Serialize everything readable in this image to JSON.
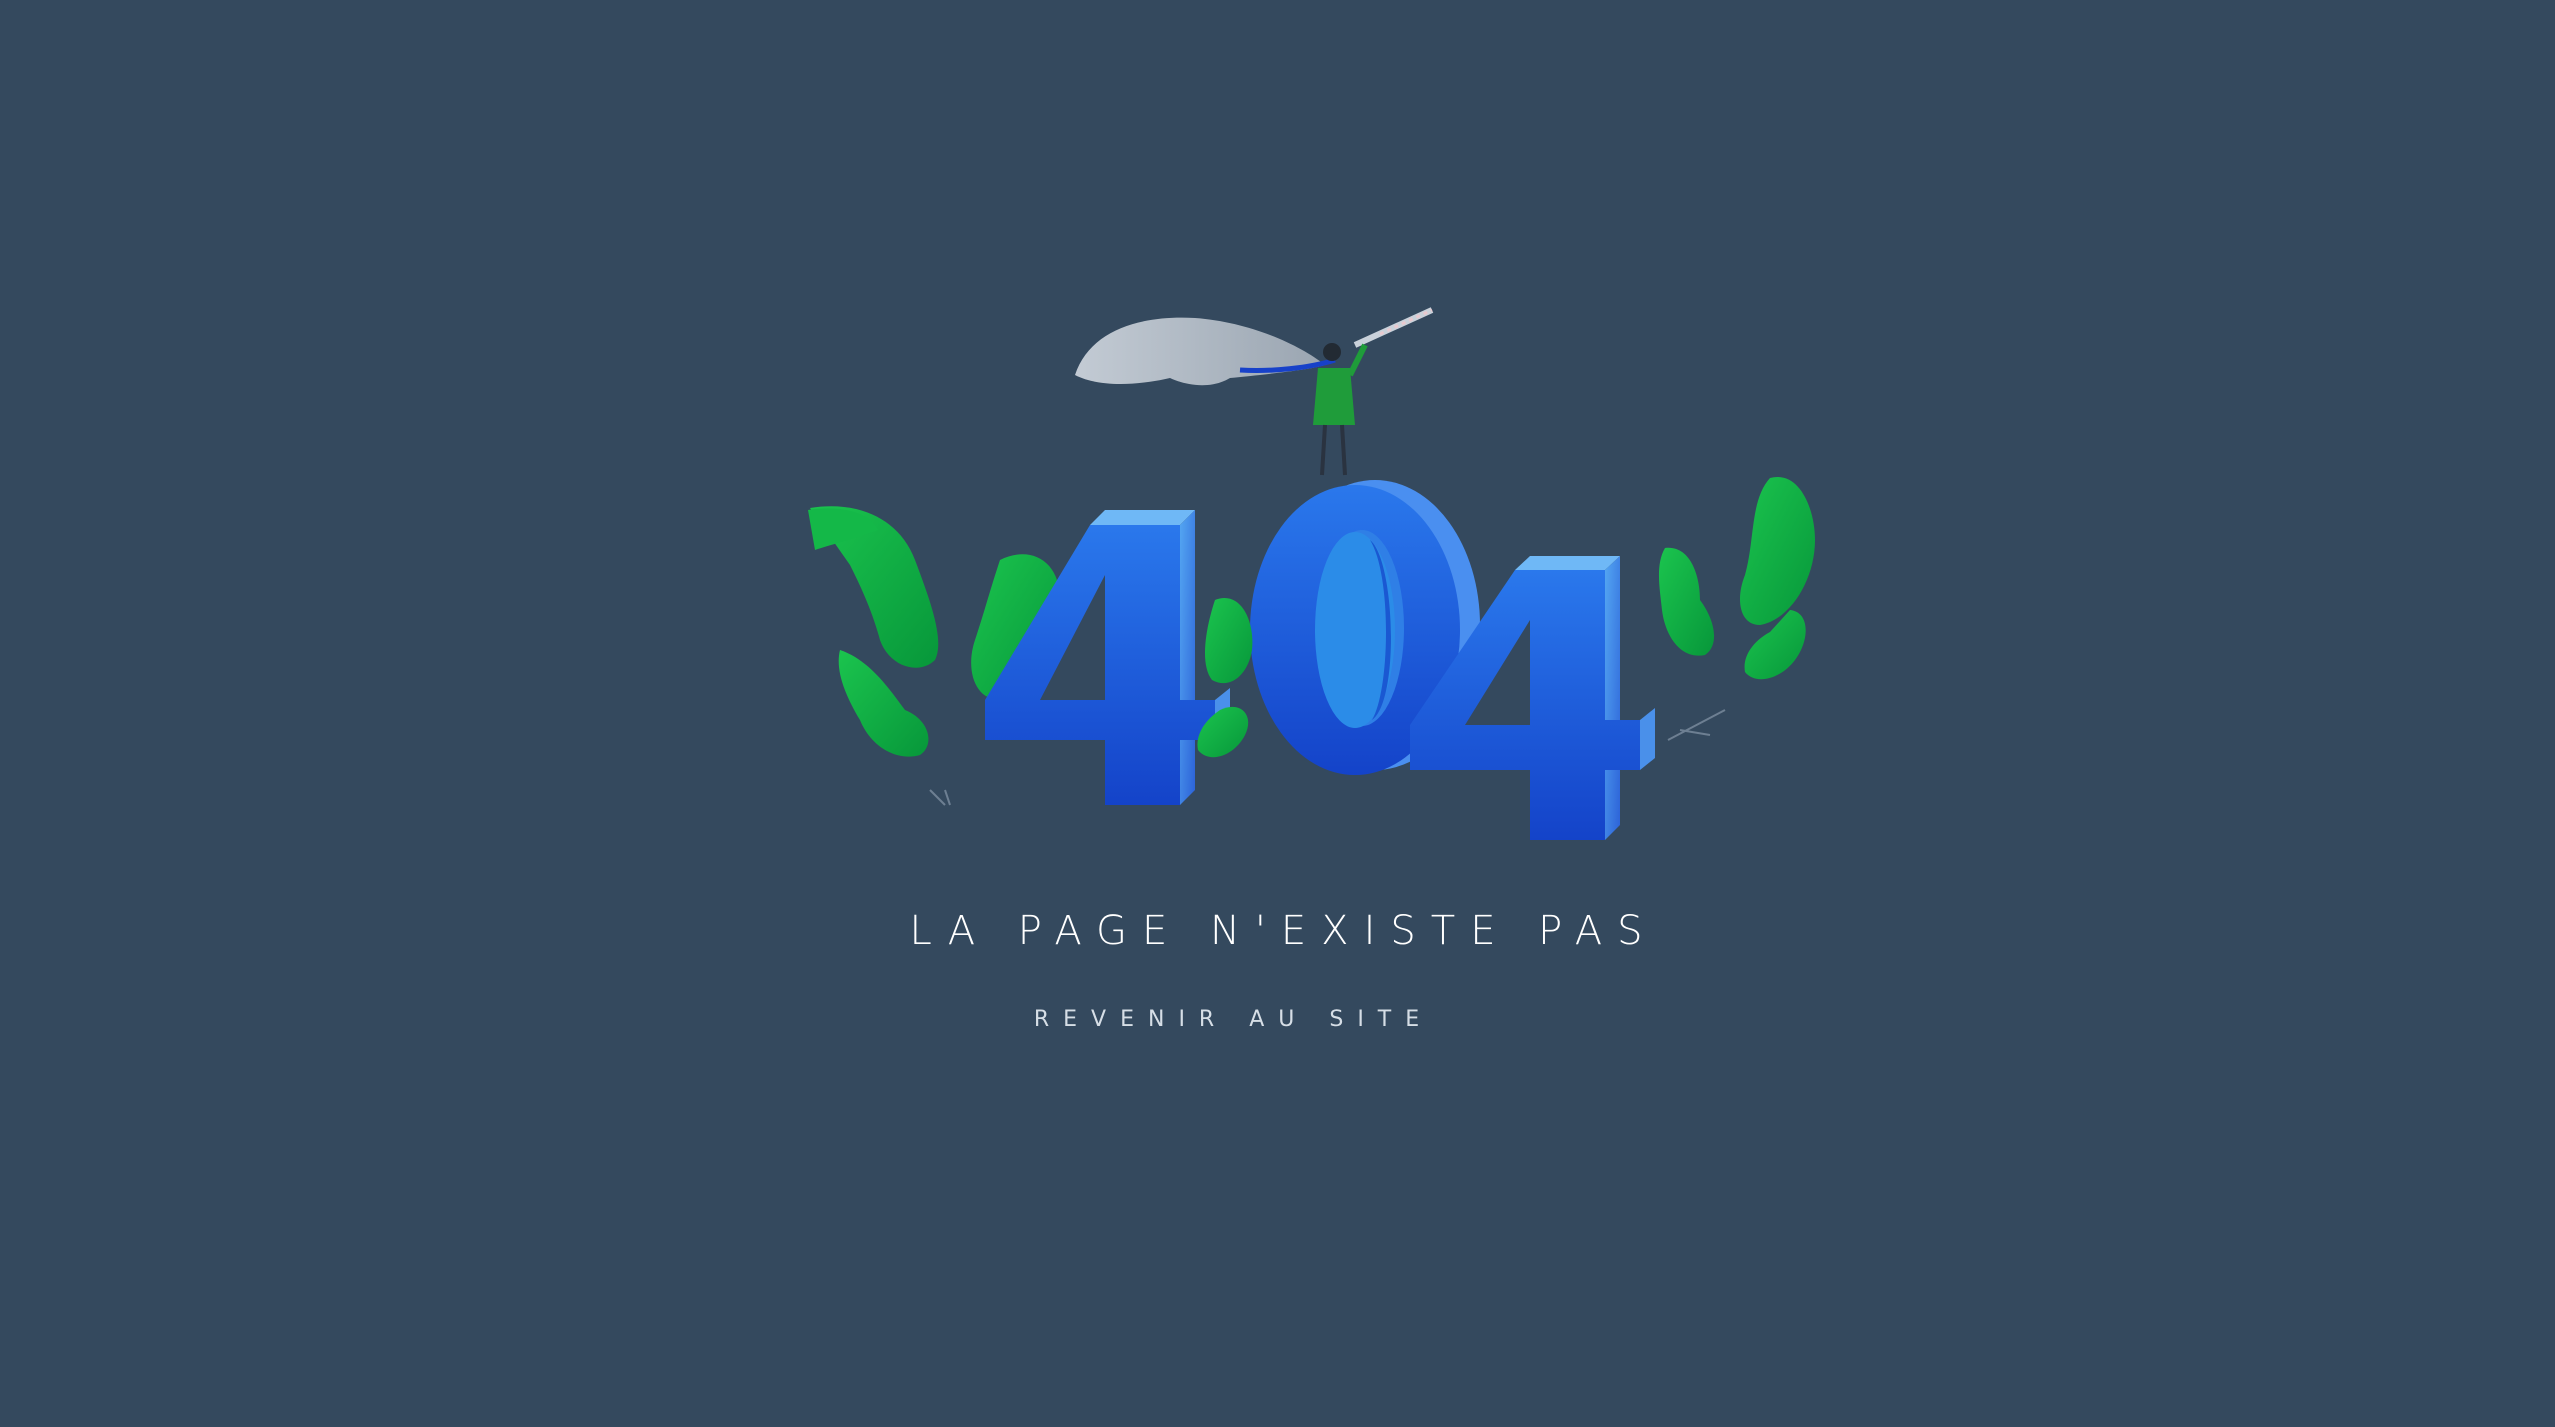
{
  "illustration": {
    "code": "404",
    "colors": {
      "background": "#34495e",
      "digit_face": "#1f5fd9",
      "digit_side": "#3a86ea",
      "leaf": "#0fae3f",
      "leaf_dark": "#079a34",
      "smoke": "#b9c2cc"
    }
  },
  "message": "LA PAGE N'EXISTE PAS",
  "back_link": "REVENIR AU SITE"
}
